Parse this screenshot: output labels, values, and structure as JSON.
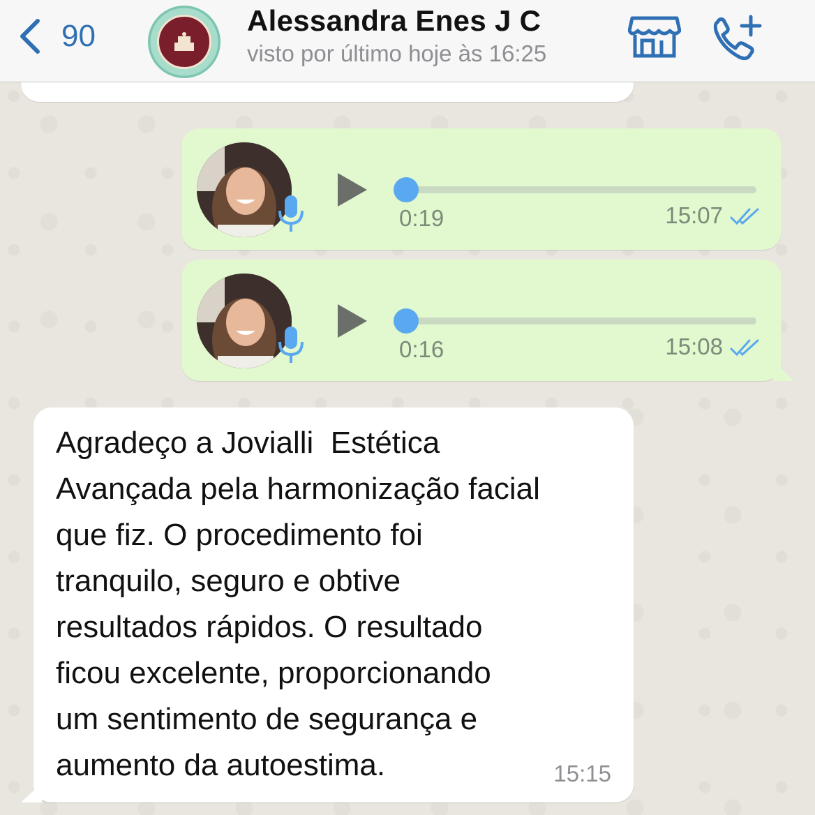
{
  "header": {
    "back_count": "90",
    "contact_name": "Alessandra Enes J C",
    "last_seen": "visto por último hoje às 16:25"
  },
  "messages": [
    {
      "type": "voice",
      "direction": "outgoing",
      "duration": "0:19",
      "time": "15:07",
      "status": "read",
      "progress": 0
    },
    {
      "type": "voice",
      "direction": "outgoing",
      "duration": "0:16",
      "time": "15:08",
      "status": "read",
      "progress": 0
    },
    {
      "type": "text",
      "direction": "incoming",
      "text": "Agradeço a Jovialli  Estética\nAvançada pela harmonização facial\nque fiz. O procedimento foi\ntranquilo, seguro e obtive\nresultados rápidos. O resultado\nficou excelente, proporcionando\num sentimento de segurança e\naumento da autoestima.",
      "time": "15:15"
    }
  ],
  "colors": {
    "accent": "#2f6fb3",
    "outgoing_bubble": "#e2f8cf",
    "incoming_bubble": "#ffffff",
    "read_ticks": "#5aa8f0"
  },
  "icons": [
    "chevron-left-icon",
    "store-icon",
    "add-call-icon",
    "play-icon",
    "microphone-icon",
    "double-check-icon"
  ]
}
